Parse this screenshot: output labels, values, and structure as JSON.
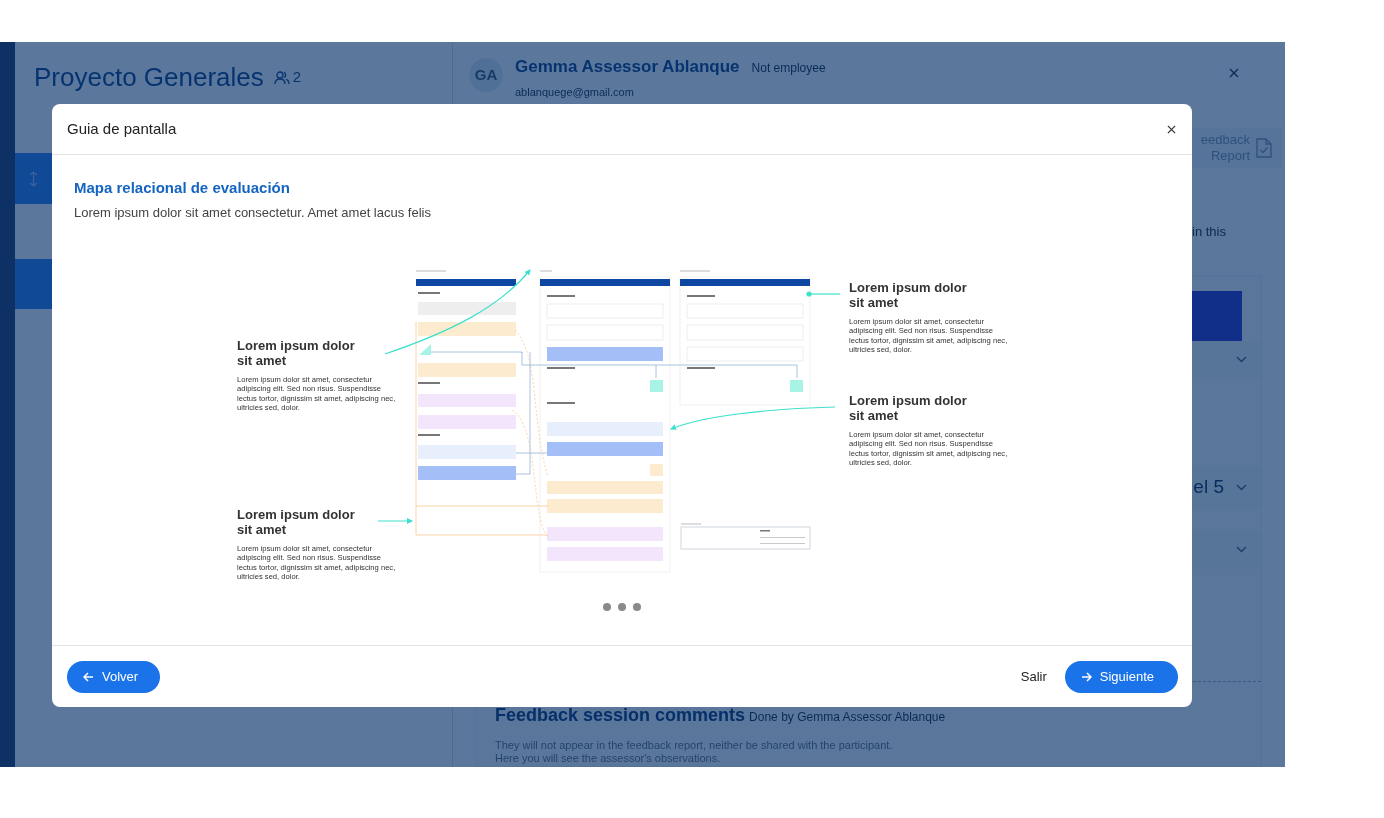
{
  "background": {
    "project": {
      "title": "Proyecto Generales",
      "members": "2"
    },
    "profile": {
      "initials": "GA",
      "name": "Gemma Assessor Ablanque",
      "status": "Not employee",
      "email": "ablanquege@gmail.com"
    },
    "feedback_button": {
      "label": "eedback Report"
    },
    "intro_fragment": "in this",
    "accordions": [
      {
        "kind": "plain"
      },
      {
        "kind": "titled",
        "label": "el 5"
      },
      {
        "kind": "plain"
      }
    ],
    "comments": {
      "title": "Feedback session comments",
      "byline": "Done by Gemma Assessor Ablanque",
      "notes": [
        "They will not appear in the feedback report, neither be shared with the participant.",
        "Here you will see the assessor's observations."
      ]
    }
  },
  "modal": {
    "title": "Guia de pantalla",
    "heading": "Mapa relacional de evaluación",
    "subtitle": "Lorem ipsum dolor sit amet consectetur. Amet amet lacus felis",
    "callouts": [
      {
        "title": "Lorem ipsum dolor sit amet",
        "text": "Lorem ipsum dolor sit amet, consectetur adipiscing elit. Sed non risus. Suspendisse lectus tortor, dignissim sit amet, adipiscing nec, ultricies sed, dolor."
      },
      {
        "title": "Lorem ipsum dolor sit amet",
        "text": "Lorem ipsum dolor sit amet, consectetur adipiscing elit. Sed non risus. Suspendisse lectus tortor, dignissim sit amet, adipiscing nec, ultricies sed, dolor."
      },
      {
        "title": "Lorem ipsum dolor sit amet",
        "text": "Lorem ipsum dolor sit amet, consectetur adipiscing elit. Sed non risus. Suspendisse lectus tortor, dignissim sit amet, adipiscing nec, ultricies sed, dolor."
      },
      {
        "title": "Lorem ipsum dolor sit amet",
        "text": "Lorem ipsum dolor sit amet, consectetur adipiscing elit. Sed non risus. Suspendisse lectus tortor, dignissim sit amet, adipiscing nec, ultricies sed, dolor."
      }
    ],
    "buttons": {
      "back": "Volver",
      "exit": "Salir",
      "next": "Siguiente"
    }
  }
}
